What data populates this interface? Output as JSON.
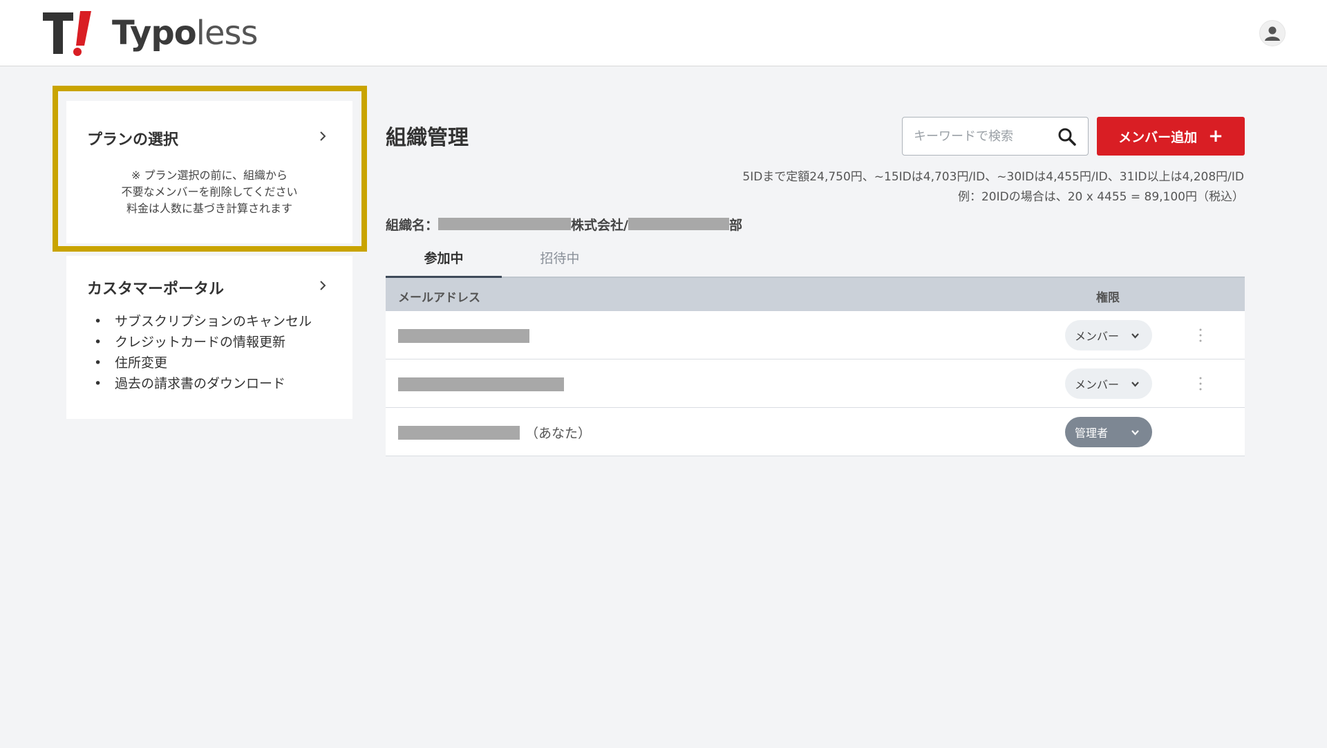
{
  "header": {
    "logo_text_bold": "Typo",
    "logo_text_light": "less",
    "avatar_icon": "user-icon"
  },
  "colors": {
    "brand_red": "#d91e24",
    "highlight": "#c9a400",
    "table_header": "#cbd1d9"
  },
  "sidebar": {
    "plan": {
      "title": "プランの選択",
      "note_lines": [
        "※ プラン選択の前に、組織から",
        "不要なメンバーを削除してください",
        "料金は人数に基づき計算されます"
      ]
    },
    "portal": {
      "title": "カスタマーポータル",
      "items": [
        "サブスクリプションのキャンセル",
        "クレジットカードの情報更新",
        "住所変更",
        "過去の請求書のダウンロード"
      ]
    }
  },
  "main": {
    "title": "組織管理",
    "search": {
      "placeholder": "キーワードで検索",
      "value": ""
    },
    "add_button_label": "メンバー追加",
    "add_button_plus": "+",
    "pricing": {
      "line1": "5IDまで定額24,750円、~15IDは4,703円/ID、~30IDは4,455円/ID、31ID以上は4,208円/ID",
      "line2": "例：20IDの場合は、20 x 4455 = 89,100円（税込）"
    },
    "org": {
      "label": "組織名：",
      "company_suffix": "株式会社/",
      "dept_suffix": "部"
    },
    "tabs": [
      {
        "label": "参加中",
        "active": true
      },
      {
        "label": "招待中",
        "active": false
      }
    ],
    "table": {
      "headers": {
        "email": "メールアドレス",
        "role": "権限"
      },
      "rows": [
        {
          "role": "メンバー",
          "you": ""
        },
        {
          "role": "メンバー",
          "you": ""
        },
        {
          "role": "管理者",
          "you": "（あなた）"
        }
      ]
    }
  }
}
